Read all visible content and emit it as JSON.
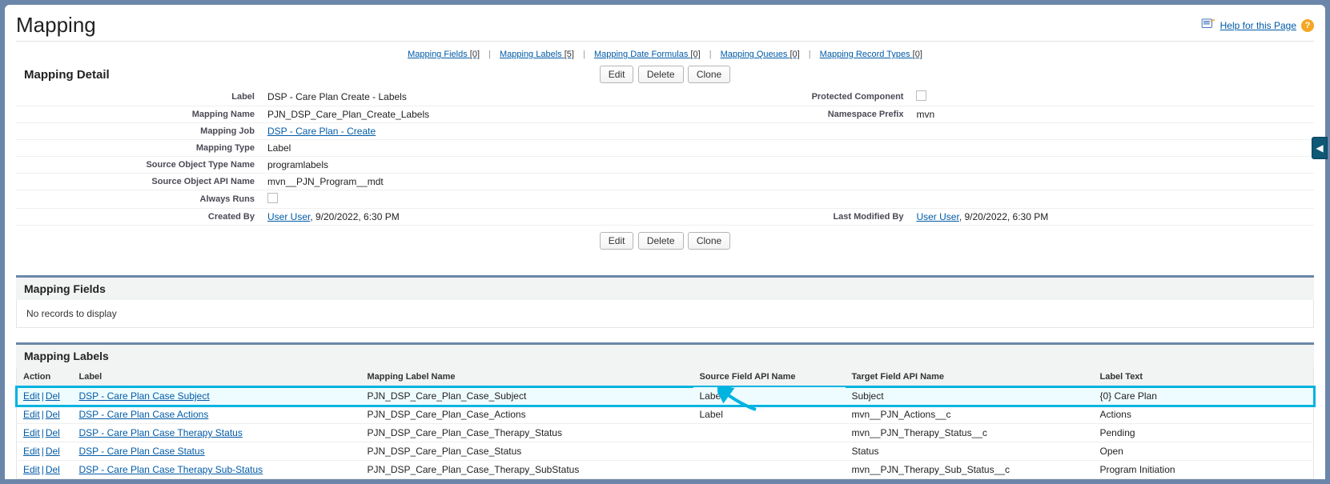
{
  "header": {
    "title": "Mapping",
    "help_text": "Help for this Page"
  },
  "related_links": [
    {
      "label": "Mapping Fields",
      "count": "[0]"
    },
    {
      "label": "Mapping Labels",
      "count": "[5]"
    },
    {
      "label": "Mapping Date Formulas",
      "count": "[0]"
    },
    {
      "label": "Mapping Queues",
      "count": "[0]"
    },
    {
      "label": "Mapping Record Types",
      "count": "[0]"
    }
  ],
  "detail": {
    "section_title": "Mapping Detail",
    "buttons": {
      "edit": "Edit",
      "delete": "Delete",
      "clone": "Clone"
    },
    "rows": {
      "label_lbl": "Label",
      "label_val": "DSP - Care Plan Create - Labels",
      "protected_lbl": "Protected Component",
      "mapping_name_lbl": "Mapping Name",
      "mapping_name_val": "PJN_DSP_Care_Plan_Create_Labels",
      "namespace_lbl": "Namespace Prefix",
      "namespace_val": "mvn",
      "mapping_job_lbl": "Mapping Job",
      "mapping_job_val": "DSP - Care Plan - Create",
      "mapping_type_lbl": "Mapping Type",
      "mapping_type_val": "Label",
      "src_type_lbl": "Source Object Type Name",
      "src_type_val": "programlabels",
      "src_api_lbl": "Source Object API Name",
      "src_api_val": "mvn__PJN_Program__mdt",
      "always_runs_lbl": "Always Runs",
      "created_by_lbl": "Created By",
      "created_by_user": "User User",
      "created_by_ts": ", 9/20/2022, 6:30 PM",
      "modified_by_lbl": "Last Modified By",
      "modified_by_user": "User User",
      "modified_by_ts": ", 9/20/2022, 6:30 PM"
    }
  },
  "fields_section": {
    "title": "Mapping Fields",
    "empty": "No records to display"
  },
  "labels_section": {
    "title": "Mapping Labels",
    "columns": {
      "action": "Action",
      "label": "Label",
      "mname": "Mapping Label Name",
      "src": "Source Field API Name",
      "tgt": "Target Field API Name",
      "text": "Label Text"
    },
    "actions": {
      "edit": "Edit",
      "del": "Del"
    },
    "rows": [
      {
        "label": "DSP - Care Plan Case Subject",
        "mname": "PJN_DSP_Care_Plan_Case_Subject",
        "src": "Label",
        "tgt": "Subject",
        "text": "{0} Care Plan"
      },
      {
        "label": "DSP - Care Plan Case Actions",
        "mname": "PJN_DSP_Care_Plan_Case_Actions",
        "src": "Label",
        "tgt": "mvn__PJN_Actions__c",
        "text": "Actions"
      },
      {
        "label": "DSP - Care Plan Case Therapy Status",
        "mname": "PJN_DSP_Care_Plan_Case_Therapy_Status",
        "src": "",
        "tgt": "mvn__PJN_Therapy_Status__c",
        "text": "Pending"
      },
      {
        "label": "DSP - Care Plan Case Status",
        "mname": "PJN_DSP_Care_Plan_Case_Status",
        "src": "",
        "tgt": "Status",
        "text": "Open"
      },
      {
        "label": "DSP - Care Plan Case Therapy Sub-Status",
        "mname": "PJN_DSP_Care_Plan_Case_Therapy_SubStatus",
        "src": "",
        "tgt": "mvn__PJN_Therapy_Sub_Status__c",
        "text": "Program Initiation"
      }
    ]
  }
}
